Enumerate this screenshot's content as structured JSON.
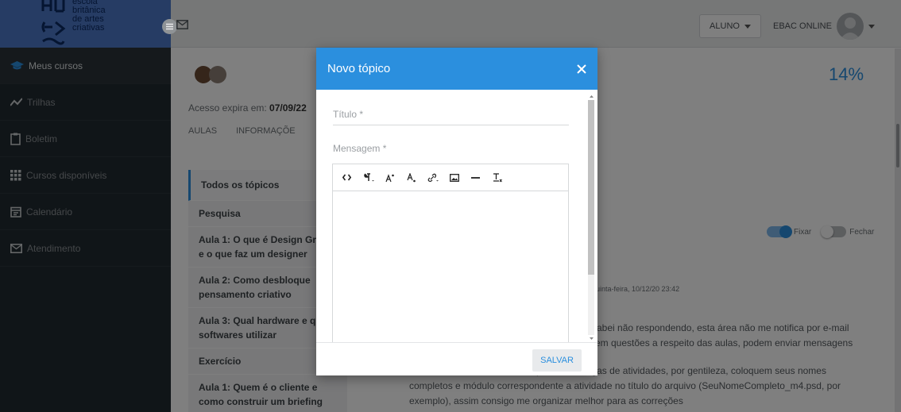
{
  "brand": {
    "lines": [
      "escola",
      "britânica",
      "de artes",
      "criativas"
    ]
  },
  "sidebar": {
    "items": [
      {
        "label": "Meus cursos",
        "icon": "graduation-cap-icon",
        "active": true
      },
      {
        "label": "Trilhas",
        "icon": "trend-line-icon"
      },
      {
        "label": "Boletim",
        "icon": "clipboard-icon"
      },
      {
        "label": "Cursos disponíveis",
        "icon": "grid-icon"
      },
      {
        "label": "Calendário",
        "icon": "calendar-icon"
      },
      {
        "label": "Atendimento",
        "icon": "mail-icon"
      }
    ]
  },
  "topbar": {
    "role_label": "ALUNO",
    "account_label": "EBAC ONLINE"
  },
  "course": {
    "access_prefix": "Acesso expira em: ",
    "access_date": "07/09/22",
    "tabs": [
      "AULAS",
      "INFORMAÇÕE"
    ],
    "progress_percent": "14%"
  },
  "topics": [
    "Todos os tópicos",
    "Pesquisa",
    "Aula 1: O que é Design Gráfico e o que faz um designer",
    "Aula 2: Como desbloque pensamento criativo",
    "Aula 3: Qual hardware e quais softwares utilizar",
    "Exercício",
    "Aula 1: Quem é o cliente e como construir um briefing"
  ],
  "forum": {
    "fix_label": "Fixar",
    "close_label": "Fechar",
    "post_date": "quinta-feira, 10/12/20 23:42",
    "post_lines": [
      "cabei não respondendo, esta área não me notifica por e-mail",
      "rem questões a respeito das aulas, podem enviar mensagens",
      "Gostaria de solicitar também que nas entregas de atividades, por gentileza, coloquem seus nomes",
      "completos e módulo correspondente a atividade no título do arquivo (SeuNomeCompleto_m4.psd, por",
      "exemplo), assim consigo me organizar melhor para as correções"
    ]
  },
  "modal": {
    "title": "Novo tópico",
    "title_field_label": "Título *",
    "message_field_label": "Mensagem *",
    "save_label": "SALVAR",
    "toolbar": [
      "code-view-icon",
      "paragraph-icon",
      "superscript-icon",
      "subscript-icon",
      "link-icon",
      "image-icon",
      "horizontal-rule-icon",
      "clear-format-icon"
    ]
  },
  "colors": {
    "accent": "#2b8fde",
    "sidebar_bg": "#212a30",
    "brand_bg": "#4d78c8"
  }
}
